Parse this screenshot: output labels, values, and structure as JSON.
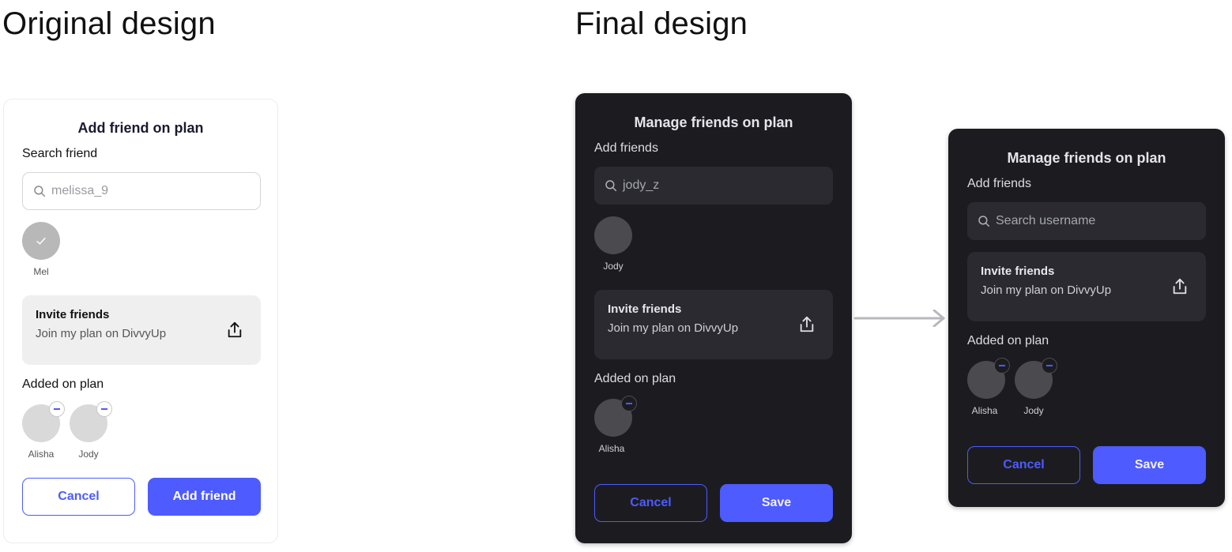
{
  "headings": {
    "original": "Original design",
    "final": "Final design"
  },
  "original": {
    "title": "Add friend on plan",
    "search_label": "Search friend",
    "search_value": "melissa_9",
    "result": {
      "name": "Mel",
      "selected": true
    },
    "invite": {
      "title": "Invite friends",
      "subtitle": "Join my plan on DivvyUp",
      "icon": "share-icon"
    },
    "added_label": "Added on plan",
    "added": [
      {
        "name": "Alisha"
      },
      {
        "name": "Jody"
      }
    ],
    "cancel_label": "Cancel",
    "primary_label": "Add friend"
  },
  "final_a": {
    "title": "Manage friends on plan",
    "search_label": "Add friends",
    "search_value": "jody_z",
    "result": {
      "name": "Jody"
    },
    "invite": {
      "title": "Invite friends",
      "subtitle": "Join my plan on DivvyUp",
      "icon": "share-icon"
    },
    "added_label": "Added on plan",
    "added": [
      {
        "name": "Alisha"
      }
    ],
    "cancel_label": "Cancel",
    "primary_label": "Save"
  },
  "final_b": {
    "title": "Manage friends on plan",
    "search_label": "Add friends",
    "search_placeholder": "Search username",
    "invite": {
      "title": "Invite friends",
      "subtitle": "Join my plan on DivvyUp",
      "icon": "share-icon"
    },
    "added_label": "Added on plan",
    "added": [
      {
        "name": "Alisha"
      },
      {
        "name": "Jody"
      }
    ],
    "cancel_label": "Cancel",
    "primary_label": "Save"
  },
  "colors": {
    "accent": "#4d5bff",
    "dark_surface": "#1c1c20",
    "dark_field": "#2a2a30",
    "light_field": "#efefef"
  }
}
